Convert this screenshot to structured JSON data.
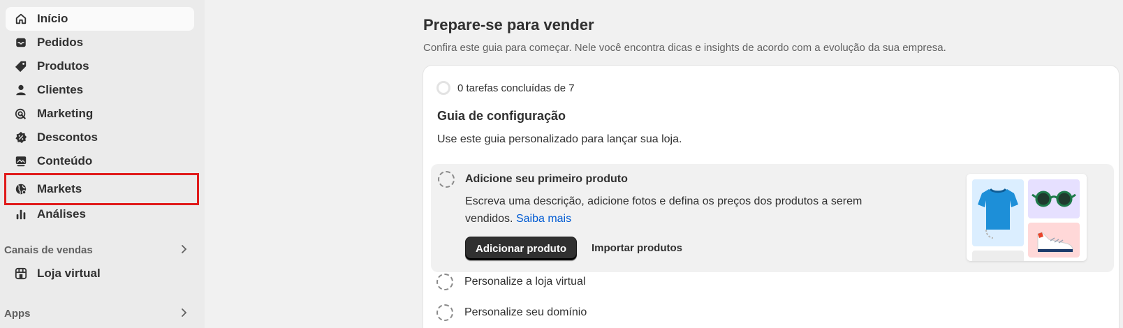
{
  "sidebar": {
    "items": [
      {
        "label": "Início",
        "icon": "home-icon"
      },
      {
        "label": "Pedidos",
        "icon": "inbox-icon"
      },
      {
        "label": "Produtos",
        "icon": "tag-icon"
      },
      {
        "label": "Clientes",
        "icon": "person-icon"
      },
      {
        "label": "Marketing",
        "icon": "target-icon"
      },
      {
        "label": "Descontos",
        "icon": "discount-icon"
      },
      {
        "label": "Conteúdo",
        "icon": "image-icon"
      },
      {
        "label": "Markets",
        "icon": "globe-icon"
      },
      {
        "label": "Análises",
        "icon": "bar-chart-icon"
      }
    ],
    "sales_channels": {
      "label": "Canais de vendas",
      "items": [
        {
          "label": "Loja virtual",
          "icon": "store-icon"
        }
      ]
    },
    "apps": {
      "label": "Apps"
    }
  },
  "main": {
    "title": "Prepare-se para vender",
    "subtitle": "Confira este guia para começar. Nele você encontra dicas e insights de acordo com a evolução da sua empresa.",
    "guide": {
      "progress": "0 tarefas concluídas de 7",
      "title": "Guia de configuração",
      "description": "Use este guia personalizado para lançar sua loja.",
      "active_task": {
        "title": "Adicione seu primeiro produto",
        "body": "Escreva uma descrição, adicione fotos e defina os preços dos produtos a serem vendidos.",
        "link": "Saiba mais",
        "primary_button": "Adicionar produto",
        "secondary_button": "Importar produtos"
      },
      "tasks": [
        {
          "label": "Personalize a loja virtual"
        },
        {
          "label": "Personalize seu domínio"
        }
      ]
    }
  },
  "colors": {
    "highlight": "#e01b1b",
    "link": "#005bd3",
    "primary_button": "#303030"
  }
}
